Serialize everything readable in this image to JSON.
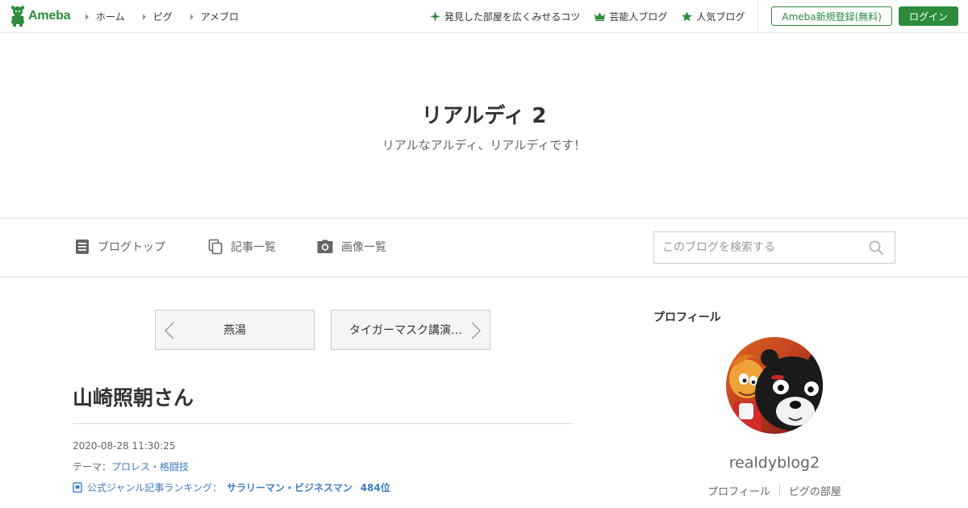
{
  "brand": {
    "name": "Ameba"
  },
  "top_nav": [
    {
      "label": "ホーム"
    },
    {
      "label": "ピグ"
    },
    {
      "label": "アメブロ"
    }
  ],
  "top_links": [
    {
      "label": "発見した部屋を広くみせるコツ",
      "icon": "sparkle-icon"
    },
    {
      "label": "芸能人ブログ",
      "icon": "crown-icon"
    },
    {
      "label": "人気ブログ",
      "icon": "star-icon"
    }
  ],
  "auth": {
    "register_label": "Ameba新規登録(無料)",
    "login_label": "ログイン"
  },
  "blog": {
    "title": "リアルディ 2",
    "description": "リアルなアルディ、リアルディです！"
  },
  "blog_nav": [
    {
      "label": "ブログトップ",
      "icon": "document-icon"
    },
    {
      "label": "記事一覧",
      "icon": "copy-icon"
    },
    {
      "label": "画像一覧",
      "icon": "camera-icon"
    }
  ],
  "search": {
    "placeholder": "このブログを検索する"
  },
  "pager": {
    "prev_label": "燕湯",
    "next_label": "タイガーマスク講演…"
  },
  "article": {
    "title": "山崎照朝さん",
    "datetime": "2020-08-28 11:30:25",
    "theme_prefix": "テーマ：",
    "theme": "プロレス・格闘技",
    "ranking_label": "公式ジャンル記事ランキング：",
    "ranking_genre": "サラリーマン・ビジネスマン",
    "ranking_rank": "484位"
  },
  "sidebar": {
    "heading": "プロフィール",
    "username": "realdyblog2",
    "links": [
      {
        "label": "プロフィール"
      },
      {
        "label": "ピグの部屋"
      }
    ]
  },
  "colors": {
    "brand_green": "#2d8c3c",
    "link_blue": "#3d7cc9"
  }
}
